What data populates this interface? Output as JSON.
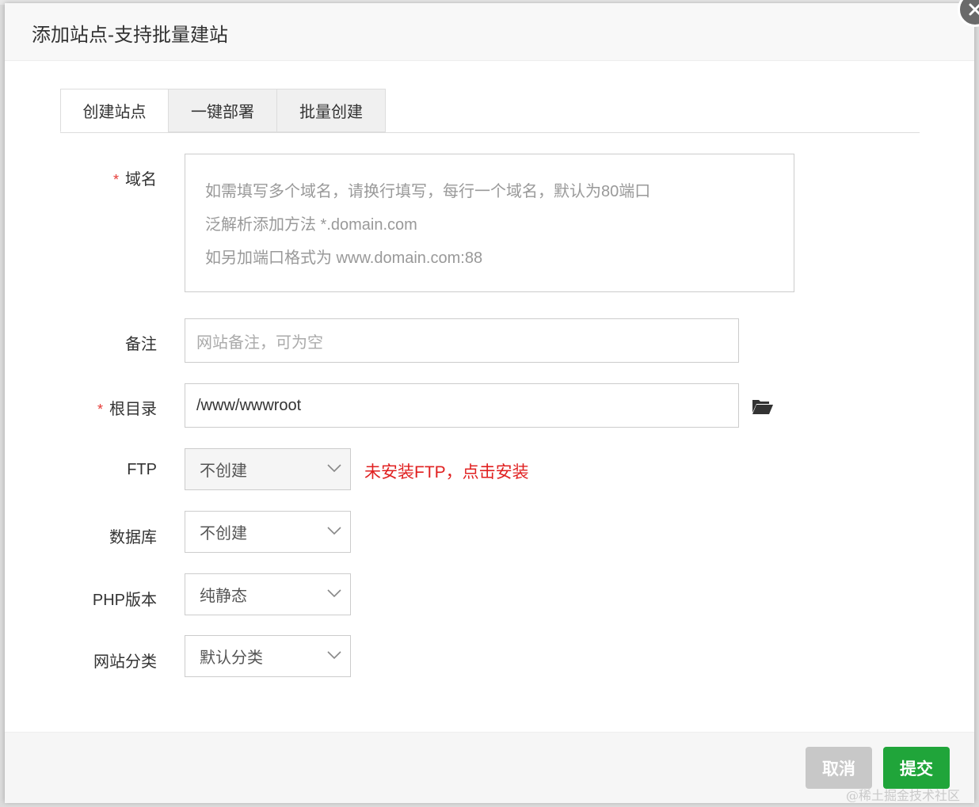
{
  "dialog": {
    "title": "添加站点-支持批量建站",
    "close_icon": "close-icon"
  },
  "tabs": [
    {
      "label": "创建站点",
      "active": true
    },
    {
      "label": "一键部署",
      "active": false
    },
    {
      "label": "批量创建",
      "active": false
    }
  ],
  "form": {
    "domain": {
      "required_mark": "*",
      "label": "域名",
      "placeholder_lines": [
        "如需填写多个域名，请换行填写，每行一个域名，默认为80端口",
        "泛解析添加方法 *.domain.com",
        "如另加端口格式为 www.domain.com:88"
      ]
    },
    "remark": {
      "label": "备注",
      "placeholder": "网站备注，可为空"
    },
    "root": {
      "required_mark": "*",
      "label": "根目录",
      "value": "/www/wwwroot",
      "icon": "folder-open-icon"
    },
    "ftp": {
      "label": "FTP",
      "value": "不创建",
      "disabled": true,
      "notice": "未安装FTP，点击安装"
    },
    "database": {
      "label": "数据库",
      "value": "不创建"
    },
    "php": {
      "label": "PHP版本",
      "value": "纯静态"
    },
    "category": {
      "label": "网站分类",
      "value": "默认分类"
    }
  },
  "footer": {
    "cancel_label": "取消",
    "submit_label": "提交"
  },
  "watermark": "@稀土掘金技术社区",
  "colors": {
    "primary_green": "#20a53a",
    "cancel_gray": "#c8c8c8",
    "required_red": "#e53935",
    "link_red": "#e02020"
  }
}
